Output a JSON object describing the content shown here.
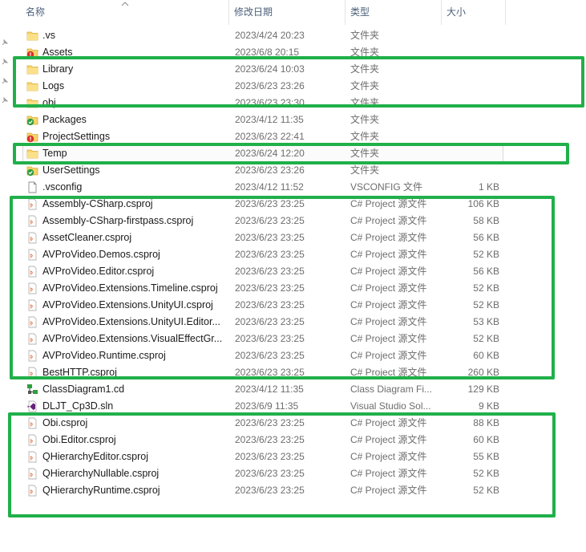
{
  "columns": {
    "name": "名称",
    "date": "修改日期",
    "type": "类型",
    "size": "大小"
  },
  "colors": {
    "highlight": "#20b04a",
    "folder": "#f7d36a",
    "header_text": "#4c607a",
    "csproj_icon": "#e0703c"
  },
  "files": [
    {
      "name": ".vs",
      "date": "2023/4/24 20:23",
      "type": "文件夹",
      "size": "",
      "icon": "folder-icon"
    },
    {
      "name": "Assets",
      "date": "2023/6/8 20:15",
      "type": "文件夹",
      "size": "",
      "icon": "folder-error-icon"
    },
    {
      "name": "Library",
      "date": "2023/6/24 10:03",
      "type": "文件夹",
      "size": "",
      "icon": "folder-icon"
    },
    {
      "name": "Logs",
      "date": "2023/6/23 23:26",
      "type": "文件夹",
      "size": "",
      "icon": "folder-icon"
    },
    {
      "name": "obj",
      "date": "2023/6/23 23:30",
      "type": "文件夹",
      "size": "",
      "icon": "folder-icon"
    },
    {
      "name": "Packages",
      "date": "2023/4/12 11:35",
      "type": "文件夹",
      "size": "",
      "icon": "folder-check-icon"
    },
    {
      "name": "ProjectSettings",
      "date": "2023/6/23 22:41",
      "type": "文件夹",
      "size": "",
      "icon": "folder-error-icon"
    },
    {
      "name": "Temp",
      "date": "2023/6/24 12:20",
      "type": "文件夹",
      "size": "",
      "icon": "folder-icon",
      "selected": true
    },
    {
      "name": "UserSettings",
      "date": "2023/6/23 23:26",
      "type": "文件夹",
      "size": "",
      "icon": "folder-check-icon"
    },
    {
      "name": ".vsconfig",
      "date": "2023/4/12 11:52",
      "type": "VSCONFIG 文件",
      "size": "1 KB",
      "icon": "file-icon"
    },
    {
      "name": "Assembly-CSharp.csproj",
      "date": "2023/6/23 23:25",
      "type": "C# Project 源文件",
      "size": "106 KB",
      "icon": "csproj-icon"
    },
    {
      "name": "Assembly-CSharp-firstpass.csproj",
      "date": "2023/6/23 23:25",
      "type": "C# Project 源文件",
      "size": "58 KB",
      "icon": "csproj-icon"
    },
    {
      "name": "AssetCleaner.csproj",
      "date": "2023/6/23 23:25",
      "type": "C# Project 源文件",
      "size": "56 KB",
      "icon": "csproj-icon"
    },
    {
      "name": "AVProVideo.Demos.csproj",
      "date": "2023/6/23 23:25",
      "type": "C# Project 源文件",
      "size": "52 KB",
      "icon": "csproj-icon"
    },
    {
      "name": "AVProVideo.Editor.csproj",
      "date": "2023/6/23 23:25",
      "type": "C# Project 源文件",
      "size": "56 KB",
      "icon": "csproj-icon"
    },
    {
      "name": "AVProVideo.Extensions.Timeline.csproj",
      "date": "2023/6/23 23:25",
      "type": "C# Project 源文件",
      "size": "52 KB",
      "icon": "csproj-icon"
    },
    {
      "name": "AVProVideo.Extensions.UnityUI.csproj",
      "date": "2023/6/23 23:25",
      "type": "C# Project 源文件",
      "size": "52 KB",
      "icon": "csproj-icon"
    },
    {
      "name": "AVProVideo.Extensions.UnityUI.Editor...",
      "date": "2023/6/23 23:25",
      "type": "C# Project 源文件",
      "size": "53 KB",
      "icon": "csproj-icon"
    },
    {
      "name": "AVProVideo.Extensions.VisualEffectGr...",
      "date": "2023/6/23 23:25",
      "type": "C# Project 源文件",
      "size": "52 KB",
      "icon": "csproj-icon"
    },
    {
      "name": "AVProVideo.Runtime.csproj",
      "date": "2023/6/23 23:25",
      "type": "C# Project 源文件",
      "size": "60 KB",
      "icon": "csproj-icon"
    },
    {
      "name": "BestHTTP.csproj",
      "date": "2023/6/23 23:25",
      "type": "C# Project 源文件",
      "size": "260 KB",
      "icon": "csproj-icon"
    },
    {
      "name": "ClassDiagram1.cd",
      "date": "2023/4/12 11:35",
      "type": "Class Diagram Fi...",
      "size": "129 KB",
      "icon": "class-diagram-icon"
    },
    {
      "name": "DLJT_Cp3D.sln",
      "date": "2023/6/9 11:35",
      "type": "Visual Studio Sol...",
      "size": "9 KB",
      "icon": "solution-icon"
    },
    {
      "name": "Obi.csproj",
      "date": "2023/6/23 23:25",
      "type": "C# Project 源文件",
      "size": "88 KB",
      "icon": "csproj-icon"
    },
    {
      "name": "Obi.Editor.csproj",
      "date": "2023/6/23 23:25",
      "type": "C# Project 源文件",
      "size": "60 KB",
      "icon": "csproj-icon"
    },
    {
      "name": "QHierarchyEditor.csproj",
      "date": "2023/6/23 23:25",
      "type": "C# Project 源文件",
      "size": "55 KB",
      "icon": "csproj-icon"
    },
    {
      "name": "QHierarchyNullable.csproj",
      "date": "2023/6/23 23:25",
      "type": "C# Project 源文件",
      "size": "52 KB",
      "icon": "csproj-icon"
    },
    {
      "name": "QHierarchyRuntime.csproj",
      "date": "2023/6/23 23:25",
      "type": "C# Project 源文件",
      "size": "52 KB",
      "icon": "csproj-icon"
    }
  ]
}
